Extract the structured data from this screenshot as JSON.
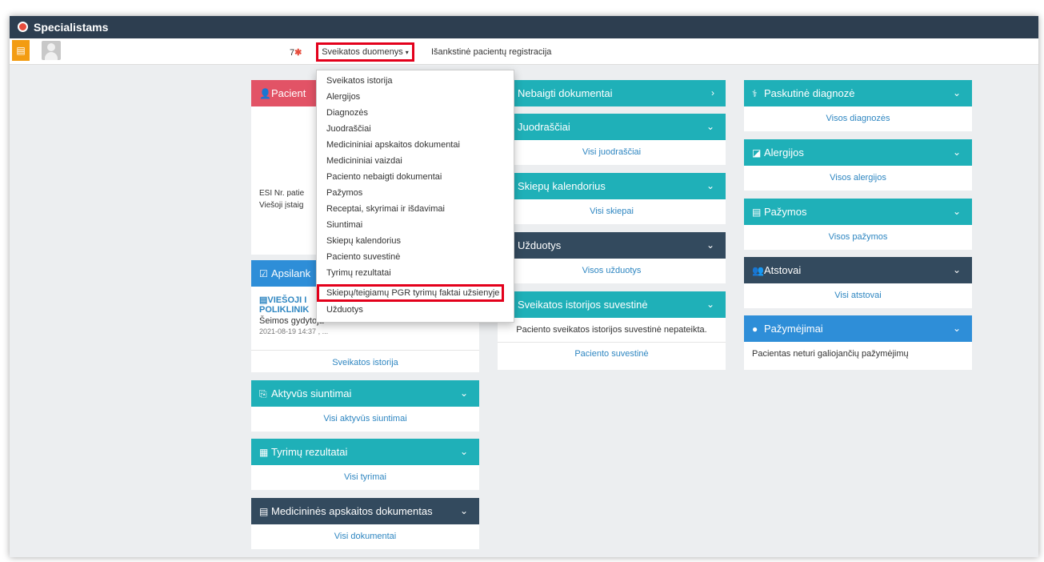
{
  "app": {
    "title": "Specialistams"
  },
  "nav": {
    "orange_icon": "document-icon",
    "count": "7",
    "count_star": "✱",
    "menu_label": "Sveikatos duomenys",
    "menu_caret": "▾",
    "registration": "Išankstinė pacientų registracija"
  },
  "dropdown": {
    "items": [
      "Sveikatos istorija",
      "Alergijos",
      "Diagnozės",
      "Juodraščiai",
      "Medicininiai apskaitos dokumentai",
      "Medicininiai vaizdai",
      "Paciento nebaigti dokumentai",
      "Pažymos",
      "Receptai, skyrimai ir išdavimai",
      "Siuntimai",
      "Skiepų kalendorius",
      "Paciento suvestinė",
      "Tyrimų rezultatai",
      "Skiepų/teigiamų PGR tyrimų faktai užsienyje",
      "Užduotys"
    ]
  },
  "left": {
    "patient": {
      "title": "Pacient",
      "line1": "ESI Nr. patie",
      "line2": "Viešoji įstaig"
    },
    "visits": {
      "title": "Apsilank",
      "org_line1": "VIEŠOJI I",
      "org_line2": "POLIKLINIK",
      "role": "Šeimos gydytoja",
      "date": "2021-08-19 14:37",
      "date_tail": ", ...",
      "link": "Sveikatos istorija"
    },
    "referrals": {
      "title": "Aktyvūs siuntimai",
      "link": "Visi aktyvūs siuntimai"
    },
    "tests": {
      "title": "Tyrimų rezultatai",
      "link": "Visi tyrimai"
    },
    "meddocs": {
      "title": "Medicininės apskaitos dokumentas",
      "link": "Visi dokumentai"
    }
  },
  "middle": {
    "unfinished": {
      "title": "Nebaigti dokumentai"
    },
    "drafts": {
      "title": "Juodraščiai",
      "link": "Visi juodraščiai"
    },
    "vaccines": {
      "title": "Skiepų kalendorius",
      "link": "Visi skiepai"
    },
    "tasks": {
      "title": "Užduotys",
      "link": "Visos užduotys"
    },
    "summary": {
      "title": "Sveikatos istorijos suvestinė",
      "text": "Paciento sveikatos istorijos suvestinė nepateikta.",
      "link": "Paciento suvestinė"
    }
  },
  "right": {
    "diagnosis": {
      "title": "Paskutinė diagnozė",
      "link": "Visos diagnozės"
    },
    "allergies": {
      "title": "Alergijos",
      "link": "Visos alergijos"
    },
    "certificates": {
      "title": "Pažymos",
      "link": "Visos pažymos"
    },
    "representatives": {
      "title": "Atstovai",
      "link": "Visi atstovai"
    },
    "passes": {
      "title": "Pažymėjimai",
      "text": "Pacientas neturi galiojančių pažymėjimų"
    }
  },
  "colors": {
    "teal": "#1fb0b8",
    "dark": "#334a5e",
    "red": "#e25366",
    "blue": "#2e8ed8",
    "highlight": "#e3001b"
  }
}
